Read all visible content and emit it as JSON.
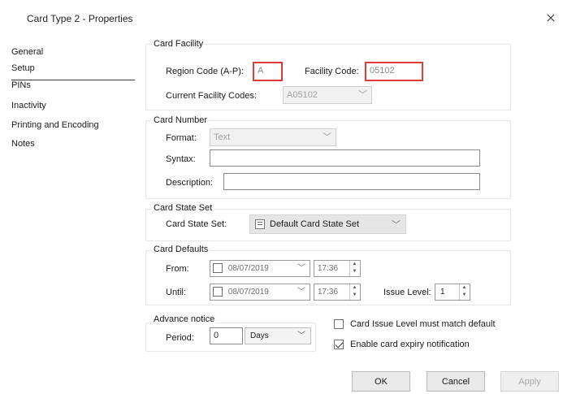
{
  "window": {
    "title": "Card Type 2 - Properties"
  },
  "sidebar": {
    "items": [
      {
        "label": "General"
      },
      {
        "label": "Setup"
      },
      {
        "label": "PINs"
      },
      {
        "label": "Inactivity"
      },
      {
        "label": "Printing and Encoding"
      },
      {
        "label": "Notes"
      }
    ]
  },
  "card_facility": {
    "legend": "Card Facility",
    "region_label": "Region Code (A-P):",
    "region_value": "A",
    "facility_label": "Facility Code:",
    "facility_value": "05102",
    "current_label": "Current Facility Codes:",
    "current_value": "A05102"
  },
  "card_number": {
    "legend": "Card Number",
    "format_label": "Format:",
    "format_value": "Text",
    "syntax_label": "Syntax:",
    "syntax_value": "",
    "description_label": "Description:",
    "description_value": ""
  },
  "card_state_set": {
    "legend": "Card State Set",
    "label": "Card State Set:",
    "value": "Default Card State Set"
  },
  "card_defaults": {
    "legend": "Card Defaults",
    "from_label": "From:",
    "from_date": "08/07/2019",
    "from_time": "17:36",
    "until_label": "Until:",
    "until_date": "08/07/2019",
    "until_time": "17:36",
    "issue_level_label": "Issue Level:",
    "issue_level_value": "1"
  },
  "advance_notice": {
    "legend": "Advance notice",
    "period_label": "Period:",
    "period_value": "0",
    "unit_value": "Days"
  },
  "options": {
    "issue_level_match_label": "Card Issue Level must match default",
    "issue_level_match_checked": false,
    "expiry_notification_label": "Enable card expiry notification",
    "expiry_notification_checked": true
  },
  "buttons": {
    "ok": "OK",
    "cancel": "Cancel",
    "apply": "Apply"
  }
}
